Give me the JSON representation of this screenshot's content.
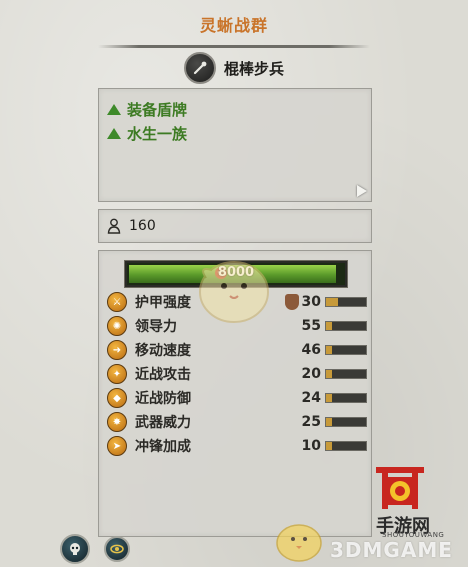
{
  "faction": {
    "title": "灵蜥战群"
  },
  "unit": {
    "name": "棍棒步兵",
    "icon": "club-icon"
  },
  "traits": [
    {
      "label": "装备盾牌",
      "icon": "triangle-up-icon",
      "color": "#3d7b23"
    },
    {
      "label": "水生一族",
      "icon": "triangle-up-icon",
      "color": "#3d7b23"
    }
  ],
  "unit_size": {
    "value": "160",
    "icon": "person-icon"
  },
  "health": {
    "value": "8000",
    "fill_fraction": 0.97
  },
  "stats": [
    {
      "label": "护甲强度",
      "value": "30",
      "icon": "armor-icon",
      "fill_fraction": 0.3,
      "has_shield": true
    },
    {
      "label": "领导力",
      "value": "55",
      "icon": "leadership-icon",
      "fill_fraction": 0.15
    },
    {
      "label": "移动速度",
      "value": "46",
      "icon": "speed-icon",
      "fill_fraction": 0.15
    },
    {
      "label": "近战攻击",
      "value": "20",
      "icon": "melee-attack-icon",
      "fill_fraction": 0.15
    },
    {
      "label": "近战防御",
      "value": "24",
      "icon": "melee-defense-icon",
      "fill_fraction": 0.15
    },
    {
      "label": "武器威力",
      "value": "25",
      "icon": "weapon-strength-icon",
      "fill_fraction": 0.15
    },
    {
      "label": "冲锋加成",
      "value": "10",
      "icon": "charge-bonus-icon",
      "fill_fraction": 0.15
    }
  ],
  "buttons": {
    "left_icon": "skull-icon",
    "right_icon": "eye-icon"
  },
  "watermark": {
    "brand_cn": "手游网",
    "brand_en": "SHOUYOUWANG",
    "site": "3DMGAME"
  }
}
